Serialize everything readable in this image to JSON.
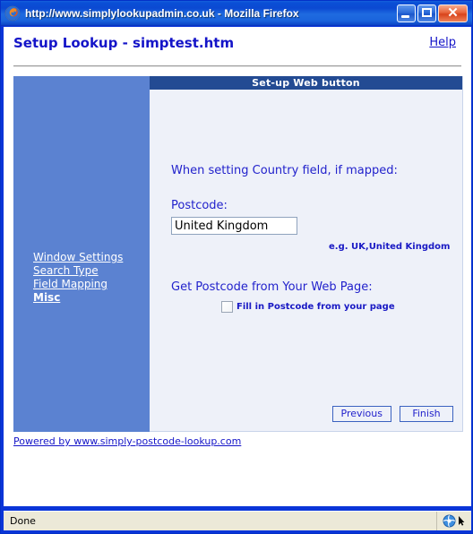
{
  "window": {
    "title": "http://www.simplylookupadmin.co.uk - Mozilla Firefox",
    "app_icon": "firefox-icon",
    "controls": {
      "minimize": "minimize-button",
      "maximize": "maximize-button",
      "close": "close-button",
      "close_glyph": "✕"
    }
  },
  "page": {
    "title": "Setup Lookup - simptest.htm",
    "help_label": "Help"
  },
  "sidebar": {
    "items": [
      {
        "label": "Window Settings",
        "current": false
      },
      {
        "label": "Search Type",
        "current": false
      },
      {
        "label": "Field Mapping",
        "current": false
      },
      {
        "label": "Misc",
        "current": true
      }
    ]
  },
  "content": {
    "banner": "Set-up Web button",
    "lead_text": "When setting Country field, if mapped:",
    "postcode_label": "Postcode:",
    "postcode_value": "United Kingdom",
    "postcode_placeholder": "",
    "postcode_hint": "e.g. UK,United Kingdom",
    "section_label": "Get Postcode from Your Web Page:",
    "checkbox_label": "Fill in Postcode from your page",
    "checkbox_checked": false,
    "buttons": {
      "previous": "Previous",
      "finish": "Finish"
    }
  },
  "footer": {
    "powered_by": "Powered by www.simply-postcode-lookup.com"
  },
  "statusbar": {
    "status": "Done",
    "globe_icon": "globe-icon",
    "cursor_icon": "cursor-arrow-icon"
  },
  "colors": {
    "title_blue": "#0A4FD6",
    "link_blue": "#1414C8",
    "text_blue": "#2222CC",
    "sidebar_blue": "#5B82D1",
    "banner_navy": "#234B93",
    "content_bg": "#EEF1F9",
    "status_bg": "#ECE9D8"
  }
}
